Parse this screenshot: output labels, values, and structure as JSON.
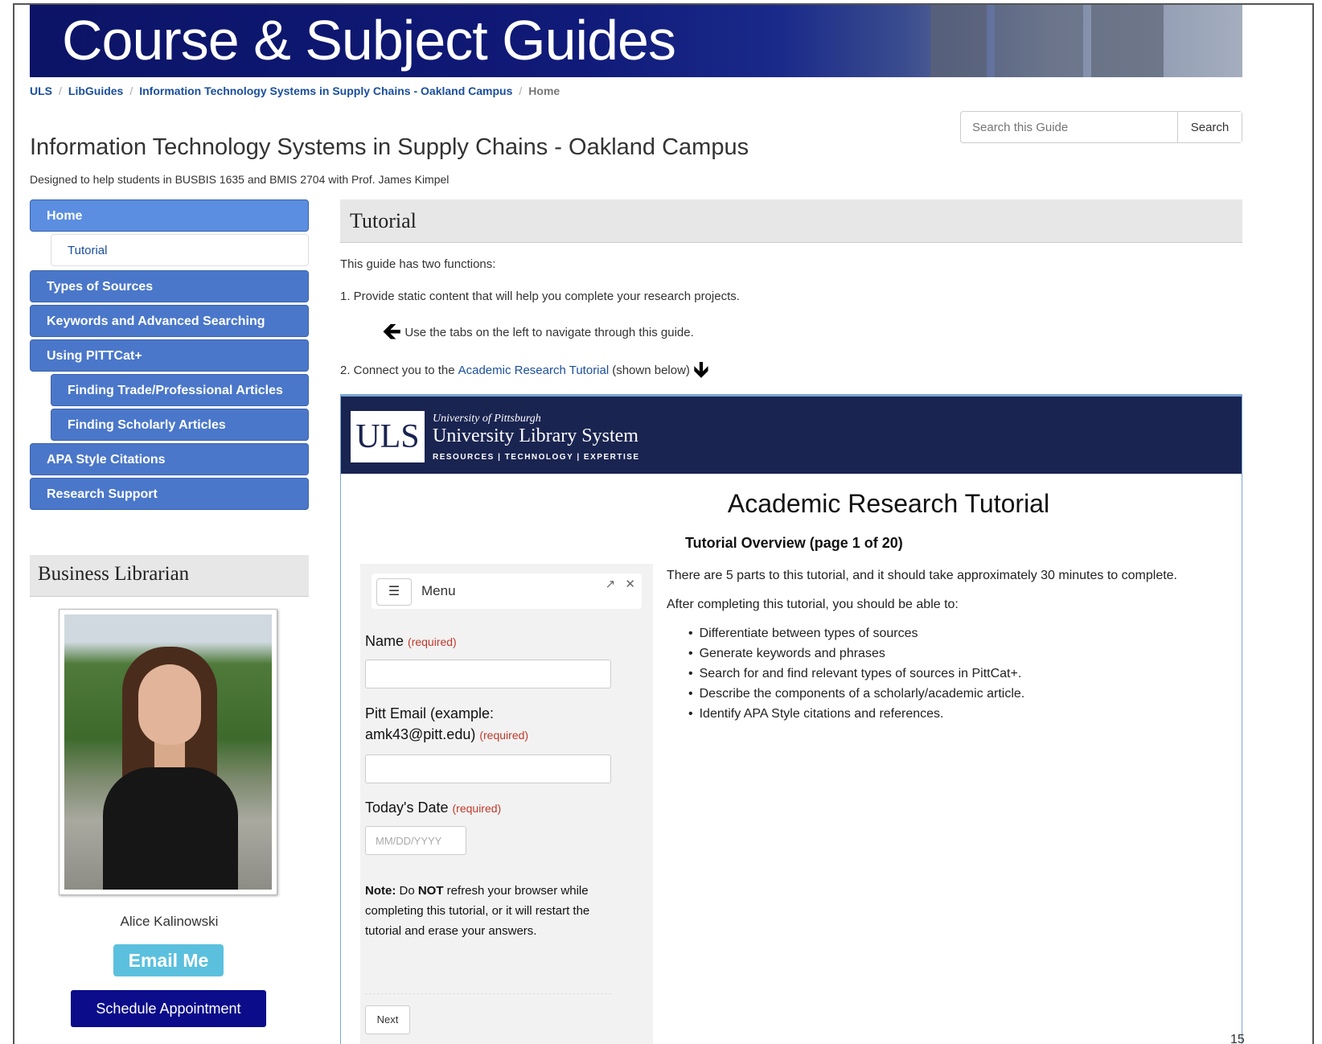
{
  "banner": {
    "title": "Course & Subject Guides"
  },
  "breadcrumbs": [
    {
      "label": "ULS"
    },
    {
      "label": "LibGuides"
    },
    {
      "label": "Information Technology Systems in Supply Chains - Oakland Campus"
    },
    {
      "label": "Home"
    }
  ],
  "search": {
    "placeholder": "Search this Guide",
    "button": "Search"
  },
  "guide": {
    "title": "Information Technology Systems in Supply Chains - Oakland Campus",
    "description": "Designed to help students in BUSBIS 1635 and BMIS 2704 with Prof. James Kimpel"
  },
  "nav": {
    "home": "Home",
    "tutorial": "Tutorial",
    "types": "Types of Sources",
    "keywords": "Keywords and Advanced Searching",
    "pittcat": "Using PITTCat+",
    "trade": "Finding Trade/Professional Articles",
    "scholarly": "Finding Scholarly Articles",
    "apa": "APA Style Citations",
    "support": "Research Support"
  },
  "librarian": {
    "heading": "Business Librarian",
    "name": "Alice Kalinowski",
    "email_button": "Email Me",
    "schedule_button": "Schedule Appointment"
  },
  "main": {
    "heading": "Tutorial",
    "line1": "This guide has two functions:",
    "line2": "1. Provide static content that will help you complete your research projects.",
    "line3": "Use the tabs on the left to navigate through this guide.",
    "line4_pre": "2. Connect you to the",
    "line4_link": "Academic Research Tutorial",
    "line4_post": "(shown below)"
  },
  "embed": {
    "logo": "ULS",
    "org_small": "University of Pittsburgh",
    "org_name": "University Library System",
    "tagline": "RESOURCES | TECHNOLOGY | EXPERTISE",
    "title": "Academic Research Tutorial",
    "subtitle": "Tutorial Overview (page 1 of 20)",
    "menu_label": "Menu",
    "form": {
      "name_label": "Name",
      "email_label_1": "Pitt Email (example:",
      "email_label_2": "amk43@pitt.edu)",
      "date_label": "Today's Date",
      "required": "(required)",
      "date_placeholder": "MM/DD/YYYY",
      "note_prefix": "Note:",
      "note_mid1": " Do ",
      "note_not": "NOT",
      "note_rest": " refresh your browser while completing this tutorial, or it will restart the tutorial and erase your answers.",
      "next": "Next"
    },
    "intro1": "There are 5 parts to this tutorial, and it should take approximately 30 minutes to complete.",
    "intro2": "After completing this tutorial, you should be able to:",
    "goals": [
      "Differentiate between types of sources",
      "Generate keywords and phrases",
      "Search for and find relevant types of sources in PittCat+.",
      "Describe the components of a scholarly/academic article.",
      "Identify APA Style citations and references."
    ]
  },
  "slide_number": "15"
}
